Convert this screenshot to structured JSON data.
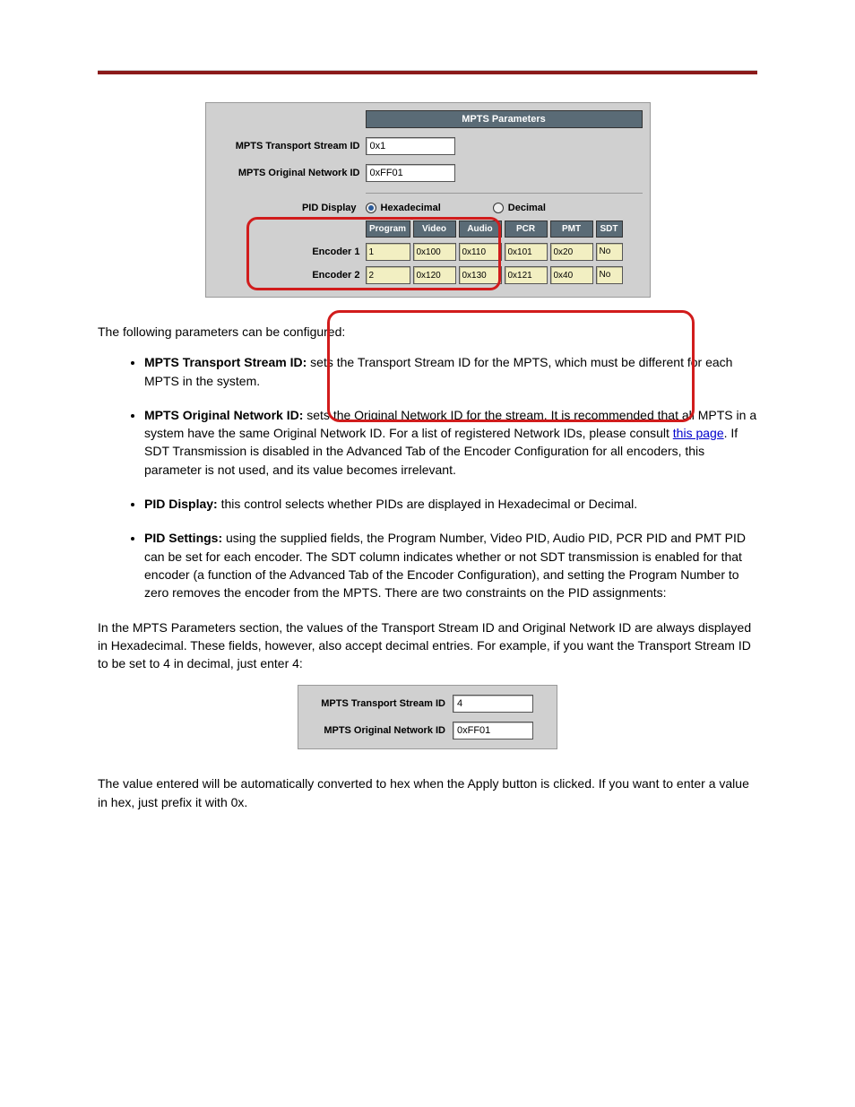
{
  "screenshot1": {
    "header": "MPTS Parameters",
    "tsid_label": "MPTS Transport Stream ID",
    "tsid_value": "0x1",
    "onid_label": "MPTS Original Network ID",
    "onid_value": "0xFF01",
    "pid_display_label": "PID Display",
    "radio_hex": "Hexadecimal",
    "radio_dec": "Decimal",
    "cols": {
      "program": "Program",
      "video": "Video",
      "audio": "Audio",
      "pcr": "PCR",
      "pmt": "PMT",
      "sdt": "SDT"
    },
    "rows": [
      {
        "label": "Encoder 1",
        "program": "1",
        "video": "0x100",
        "audio": "0x110",
        "pcr": "0x101",
        "pmt": "0x20",
        "sdt": "No"
      },
      {
        "label": "Encoder 2",
        "program": "2",
        "video": "0x120",
        "audio": "0x130",
        "pcr": "0x121",
        "pmt": "0x40",
        "sdt": "No"
      }
    ]
  },
  "text": {
    "intro": "The following parameters can be configured:",
    "b1_strong": "MPTS Transport Stream ID:",
    "b1_text": " sets the Transport Stream ID for the MPTS, which must be different for each MPTS in the system.",
    "b2_strong": "MPTS Original Network ID:",
    "b2_text": " sets the Original Network ID for the stream. It is recommended that all MPTS in a system have the same Original Network ID. For a list of registered Network IDs, please consult ",
    "b2_link": "this page",
    "b2_text2": ". If SDT Transmission is disabled in the Advanced Tab of the Encoder Configuration for all encoders, this parameter is not used, and its value becomes irrelevant.",
    "b3_strong": "PID Display:",
    "b3_text": " this control selects whether PIDs are displayed in Hexadecimal or Decimal.",
    "b4_strong": "PID Settings:",
    "b4_text": " using the supplied fields, the Program Number, Video PID, Audio PID, PCR PID and PMT PID can be set for each encoder. The SDT column indicates whether or not SDT transmission is enabled for that encoder (a function of the Advanced Tab of the Encoder Configuration), and setting the Program Number to zero removes the encoder from the MPTS. There are two constraints on the PID assignments:"
  },
  "text2": {
    "p1": "In the MPTS Parameters section, the values of the Transport Stream ID and Original Network ID are always displayed in Hexadecimal. These fields, however, also accept decimal entries. For example, if you want the Transport Stream ID to be set to 4 in decimal, just enter 4:",
    "p2": "The value entered will be automatically converted to hex when the Apply button is clicked. If you want to enter a value in hex, just prefix it with 0x."
  },
  "screenshot2": {
    "tsid_label": "MPTS Transport Stream ID",
    "tsid_value": "4",
    "onid_label": "MPTS Original Network ID",
    "onid_value": "0xFF01"
  }
}
